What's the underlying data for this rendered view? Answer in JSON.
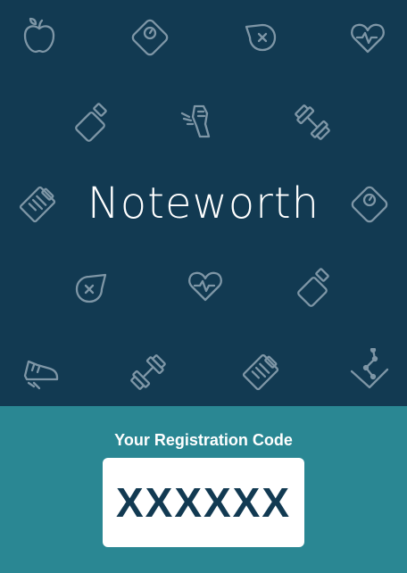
{
  "app": {
    "brand_name": "Noteworth"
  },
  "registration": {
    "label": "Your Registration Code",
    "code": "XXXXXX"
  },
  "colors": {
    "header_background": "#123a52",
    "footer_background": "#2a8793",
    "icon_stroke": "#7e96a6",
    "code_text": "#123a52",
    "code_box": "#ffffff"
  },
  "background_icons": [
    "apple-icon",
    "scale-icon",
    "blood-drop-icon",
    "heart-rate-icon",
    "pill-bottle-icon",
    "running-shoe-icon",
    "dumbbell-icon",
    "clipboard-icon",
    "scale-icon",
    "blood-drop-icon",
    "heart-rate-icon",
    "pill-bottle-icon",
    "running-shoe-icon",
    "dumbbell-icon",
    "clipboard-icon",
    "line-chart-icon"
  ]
}
